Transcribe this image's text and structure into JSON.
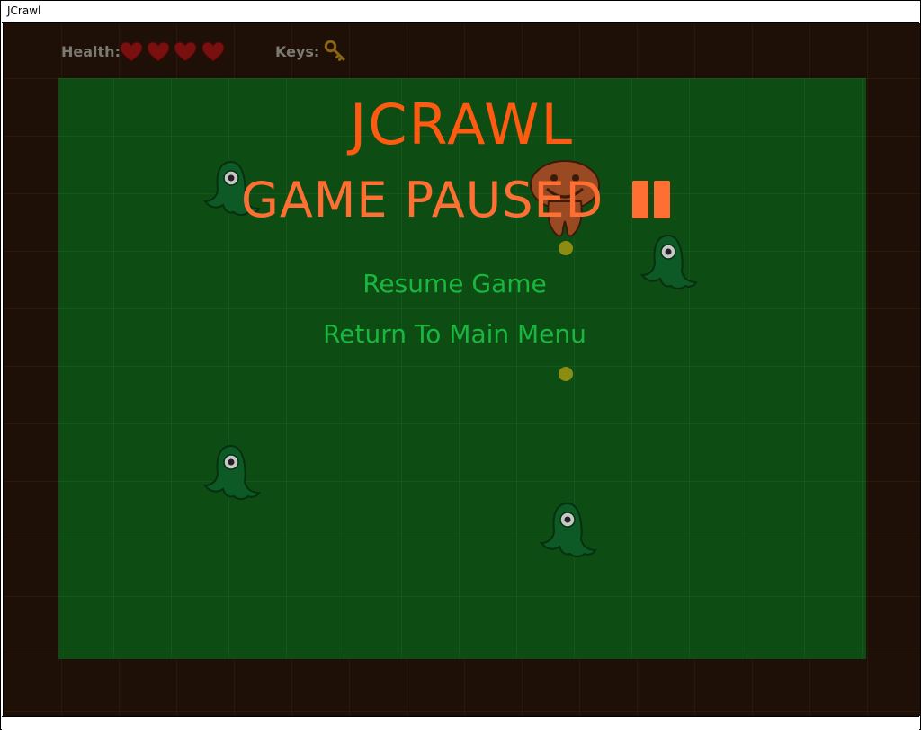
{
  "window": {
    "title": "JCrawl"
  },
  "hud": {
    "health_label": "Health:",
    "health_count": 4,
    "keys_label": "Keys:",
    "keys_count": 1,
    "heart_icon": "heart-icon",
    "key_icon": "key-icon"
  },
  "overlay": {
    "game_title": "JCRAWL",
    "status": "GAME PAUSED",
    "status_icon": "pause-icon",
    "menu": [
      {
        "label": "Resume Game"
      },
      {
        "label": "Return To Main Menu"
      }
    ]
  },
  "colors": {
    "wall": "#1e1006",
    "floor": "#0d4d13",
    "title": "#ff5a10",
    "status": "#ff6f33",
    "menu_text": "#1bb640",
    "heart": "#7a0f0f",
    "key": "#8a6412",
    "coin": "#8c8c12",
    "monster": "#0d5a26"
  }
}
